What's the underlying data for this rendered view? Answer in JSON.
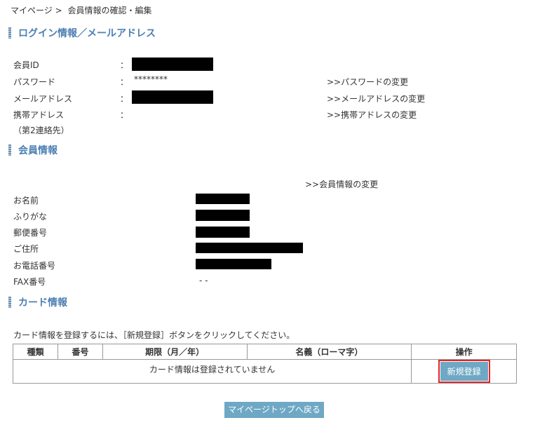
{
  "breadcrumb": {
    "home": "マイページ",
    "separator": ">",
    "current": "会員情報の確認・編集"
  },
  "login_section": {
    "title": "ログイン情報／メールアドレス",
    "member_id_label": "会員ID",
    "password_label": "パスワード",
    "password_value": "********",
    "email_label": "メールアドレス",
    "mobile_label": "携帯アドレス",
    "mobile_sub_label": "（第2連絡先）",
    "colon": "：",
    "change_password_link": ">>パスワードの変更",
    "change_email_link": ">>メールアドレスの変更",
    "change_mobile_link": ">>携帯アドレスの変更"
  },
  "member_section": {
    "title": "会員情報",
    "change_link": ">>会員情報の変更",
    "name_label": "お名前",
    "furigana_label": "ふりがな",
    "postal_label": "郵便番号",
    "address_label": "ご住所",
    "phone_label": "お電話番号",
    "fax_label": "FAX番号",
    "fax_value": "-  -"
  },
  "card_section": {
    "title": "カード情報",
    "instruction": "カード情報を登録するには、［新規登録］ボタンをクリックしてください。",
    "columns": [
      "種類",
      "番号",
      "期限（月／年）",
      "名義（ローマ字）",
      "操作"
    ],
    "empty_message": "カード情報は登録されていません",
    "new_button": "新規登録"
  },
  "back_button": "マイページトップへ戻る",
  "colors": {
    "accent": "#4d7fb3",
    "button": "#6ea8c5",
    "highlight": "#e2262a"
  }
}
